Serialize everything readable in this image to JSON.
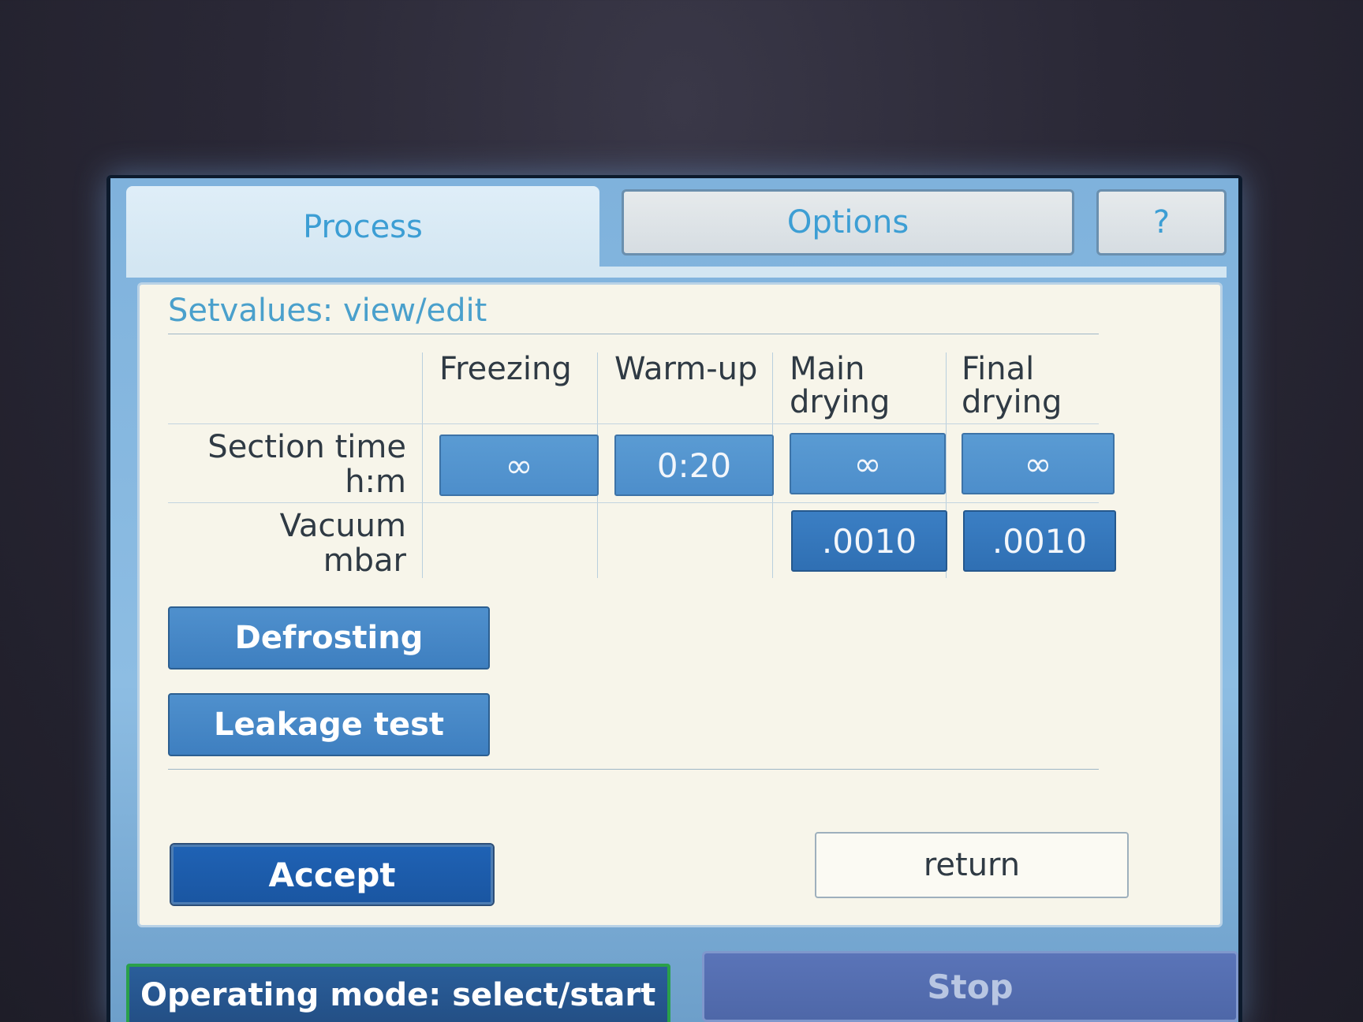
{
  "tabs": [
    {
      "label": "Process",
      "active": true
    },
    {
      "label": "Options",
      "active": false
    },
    {
      "label": "?",
      "active": false
    }
  ],
  "panel": {
    "title": "Setvalues: view/edit",
    "columns": [
      {
        "line1": "Freezing",
        "line2": ""
      },
      {
        "line1": "Warm-up",
        "line2": ""
      },
      {
        "line1": "Main",
        "line2": "drying"
      },
      {
        "line1": "Final",
        "line2": "drying"
      }
    ],
    "rows": [
      {
        "label_line1": "Section time",
        "label_line2": "h:m",
        "values": [
          "∞",
          "0:20",
          "∞",
          "∞"
        ]
      },
      {
        "label_line1": "Vacuum",
        "label_line2": "mbar",
        "values": [
          "",
          "",
          ".0010",
          ".0010"
        ]
      }
    ],
    "defrosting_label": "Defrosting",
    "leakage_test_label": "Leakage test",
    "accept_label": "Accept",
    "return_label": "return"
  },
  "status_bar": {
    "operating_mode": "Operating mode: select/start",
    "stop_label": "Stop"
  },
  "colors": {
    "screen_background": "#8dbde3",
    "panel_background": "#f7f5ea",
    "tab_text": "#3c9ed4",
    "value_button": "#4d8ecb",
    "accept_button": "#1a56a2",
    "operating_mode_border": "#2aa04a",
    "stop_button": "#4e67a8"
  }
}
